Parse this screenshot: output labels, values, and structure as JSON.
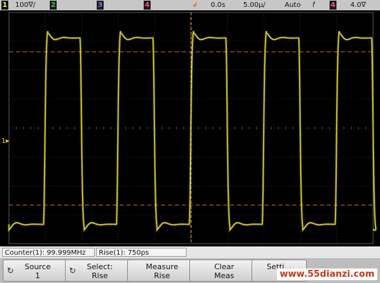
{
  "topbar": {
    "ch1_num": "1",
    "ch1_scale": "100∇/",
    "ch2_num": "2",
    "ch3_num": "3",
    "ch4_num": "4",
    "trigger_symbol": "↲",
    "time_offset": "0.0s",
    "time_scale": "5.00µ/",
    "trigger_mode": "Auto",
    "trigger_slope": "f",
    "trig_ch_num": "4",
    "trig_level": "4.0∇",
    "colors": {
      "ch1": "#f2e84a",
      "ch2": "#3ccf3c",
      "ch3": "#6a4cff",
      "ch4": "#ff4a6a"
    }
  },
  "screen": {
    "ground_marker": "1▸",
    "trace_color": "#e6dc3a",
    "grid_color": "#5a5a5a",
    "ref_line_color": "#d46a2a",
    "marker_color": "#e0a43a"
  },
  "measurements": {
    "counter": "Counter(1): 99.999MHz",
    "rise": "Rise(1): 750ps"
  },
  "softkeys": {
    "source_line1": "Source",
    "source_line2": "1",
    "select_line1": "Select:",
    "select_line2": "Rise",
    "measure_line1": "Measure",
    "measure_line2": "Rise",
    "clear_line1": "Clear",
    "clear_line2": "Meas",
    "settings_line1": "Setti..."
  },
  "watermark": "www.55dianzi.com"
}
